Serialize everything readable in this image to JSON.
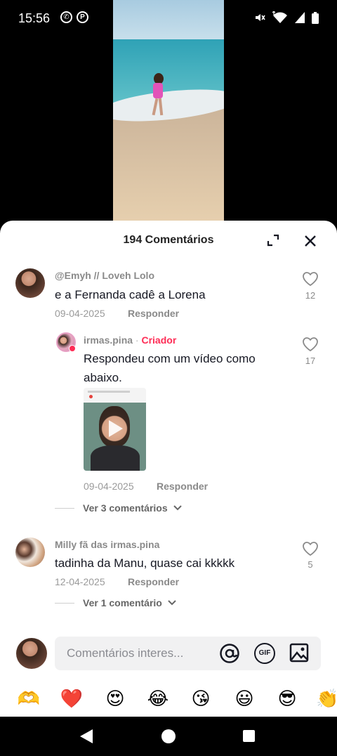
{
  "status_bar": {
    "time": "15:56",
    "left_icons": [
      "whatsapp-icon",
      "pinterest-icon"
    ],
    "right_icons": [
      "mute-icon",
      "wifi-data-icon",
      "signal-icon",
      "battery-icon"
    ]
  },
  "sheet": {
    "title": "194 Comentários"
  },
  "comments": [
    {
      "username": "@Emyh // Loveh Lolo",
      "text": "e a Fernanda cadê a Lorena",
      "date": "09-04-2025",
      "reply_label": "Responder",
      "likes": "12"
    },
    {
      "username": "irmas.pina",
      "separator": "·",
      "creator_label": "Criador",
      "text_line1": "Respondeu com um vídeo como",
      "text_line2": "abaixo.",
      "date": "09-04-2025",
      "reply_label": "Responder",
      "likes": "17"
    },
    {
      "username": "Milly fã das irmas.pina",
      "text": "tadinha da Manu, quase cai kkkkk",
      "date": "12-04-2025",
      "reply_label": "Responder",
      "likes": "5"
    }
  ],
  "view_more": [
    {
      "label": "Ver 3 comentários"
    },
    {
      "label": "Ver 1 comentário"
    }
  ],
  "input": {
    "placeholder": "Comentários interes..."
  },
  "emojis": [
    "🫶",
    "❤️",
    "😍",
    "😂",
    "😘",
    "😃",
    "😎",
    "👏"
  ],
  "colors": {
    "creator": "#fe2c55",
    "text": "#161823",
    "muted": "#8a8a8a"
  }
}
